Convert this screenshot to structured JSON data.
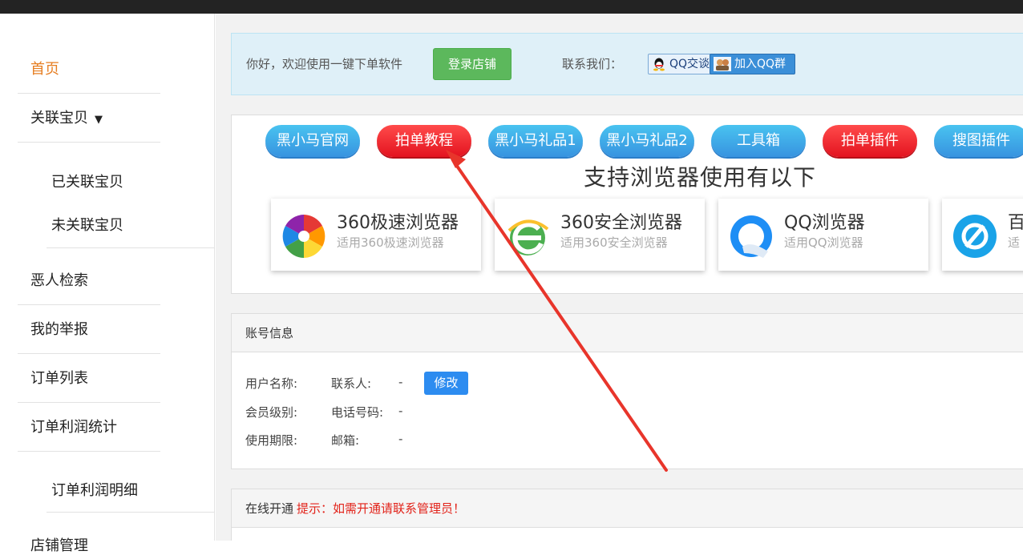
{
  "sidebar": {
    "items": [
      {
        "label": "首页"
      },
      {
        "label": "关联宝贝",
        "caret": "▼"
      },
      {
        "label": "已关联宝贝"
      },
      {
        "label": "未关联宝贝"
      },
      {
        "label": "恶人检索"
      },
      {
        "label": "我的举报"
      },
      {
        "label": "订单列表"
      },
      {
        "label": "订单利润统计"
      },
      {
        "label": "订单利润明细"
      },
      {
        "label": "店铺管理"
      }
    ],
    "active_color": "#e67e22"
  },
  "notice": {
    "greeting": "你好，欢迎使用一键下单软件",
    "login_button": "登录店铺",
    "contact_label": "联系我们：",
    "qq_chat": "QQ交谈",
    "qq_group": "加入QQ群"
  },
  "links": {
    "buttons": [
      {
        "label": "黑小马官网",
        "color": "blue"
      },
      {
        "label": "拍单教程",
        "color": "red"
      },
      {
        "label": "黑小马礼品1",
        "color": "blue"
      },
      {
        "label": "黑小马礼品2",
        "color": "blue"
      },
      {
        "label": "工具箱",
        "color": "blue"
      },
      {
        "label": "拍单插件",
        "color": "red"
      },
      {
        "label": "搜图插件",
        "color": "blue"
      }
    ],
    "browsers_title": "支持浏览器使用有以下",
    "browsers": [
      {
        "name": "360极速浏览器",
        "desc": "适用360极速浏览器",
        "icon": "360-speed-browser-icon"
      },
      {
        "name": "360安全浏览器",
        "desc": "适用360安全浏览器",
        "icon": "360-secure-browser-icon"
      },
      {
        "name": "QQ浏览器",
        "desc": "适用QQ浏览器",
        "icon": "qq-browser-icon"
      },
      {
        "name": "百",
        "desc": "适",
        "icon": "baidu-browser-icon"
      }
    ]
  },
  "account": {
    "title": "账号信息",
    "username_label": "用户名称:",
    "contact_label": "联系人:",
    "contact_value": "-",
    "edit_button": "修改",
    "level_label": "会员级别:",
    "phone_label": "电话号码:",
    "phone_value": "-",
    "period_label": "使用期限:",
    "email_label": "邮箱:",
    "email_value": "-"
  },
  "online": {
    "title": "在线开通",
    "tip": "提示：如需开通请联系管理员！"
  },
  "colors": {
    "login_green": "#5cb85c",
    "pill_blue": "#3793e0",
    "pill_red": "#e3131f",
    "edit_blue": "#2d8cf0",
    "arrow_red": "#e8352b",
    "tip_red": "#e2231a"
  }
}
